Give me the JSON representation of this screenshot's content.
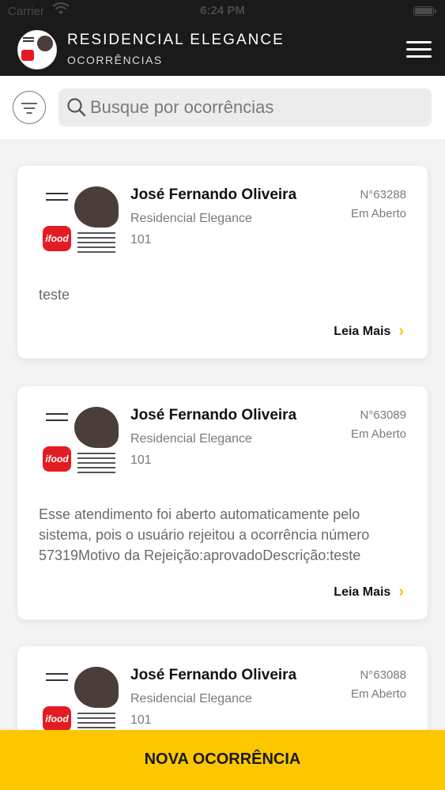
{
  "status_bar": {
    "carrier": "Carrier",
    "time": "6:24 PM"
  },
  "header": {
    "title": "RESIDENCIAL ELEGANCE",
    "subtitle": "OCORRÊNCIAS"
  },
  "search": {
    "placeholder": "Busque por ocorrências",
    "value": ""
  },
  "cards": [
    {
      "name": "José Fernando Oliveira",
      "condo": "Residencial Elegance",
      "unit": "101",
      "number": "N°63288",
      "status": "Em Aberto",
      "description": "teste",
      "read_more": "Leia Mais"
    },
    {
      "name": "José Fernando Oliveira",
      "condo": "Residencial Elegance",
      "unit": "101",
      "number": "N°63089",
      "status": "Em Aberto",
      "description": "Esse atendimento foi aberto automaticamente pelo sistema, pois o usuário rejeitou a ocorrência número 57319Motivo da Rejeição:aprovadoDescrição:teste",
      "read_more": "Leia Mais"
    },
    {
      "name": "José Fernando Oliveira",
      "condo": "Residencial Elegance",
      "unit": "101",
      "number": "N°63088",
      "status": "Em Aberto"
    }
  ],
  "footer": {
    "new_label": "NOVA OCORRÊNCIA"
  },
  "colors": {
    "accent": "#fdc700",
    "header_bg": "#1a1a1a",
    "ifood_red": "#e31c23"
  },
  "icons": {
    "wifi": "wifi-icon",
    "battery": "battery-icon",
    "menu": "hamburger-menu-icon",
    "filter": "filter-icon",
    "search": "search-icon",
    "chevron": "chevron-right-icon"
  }
}
